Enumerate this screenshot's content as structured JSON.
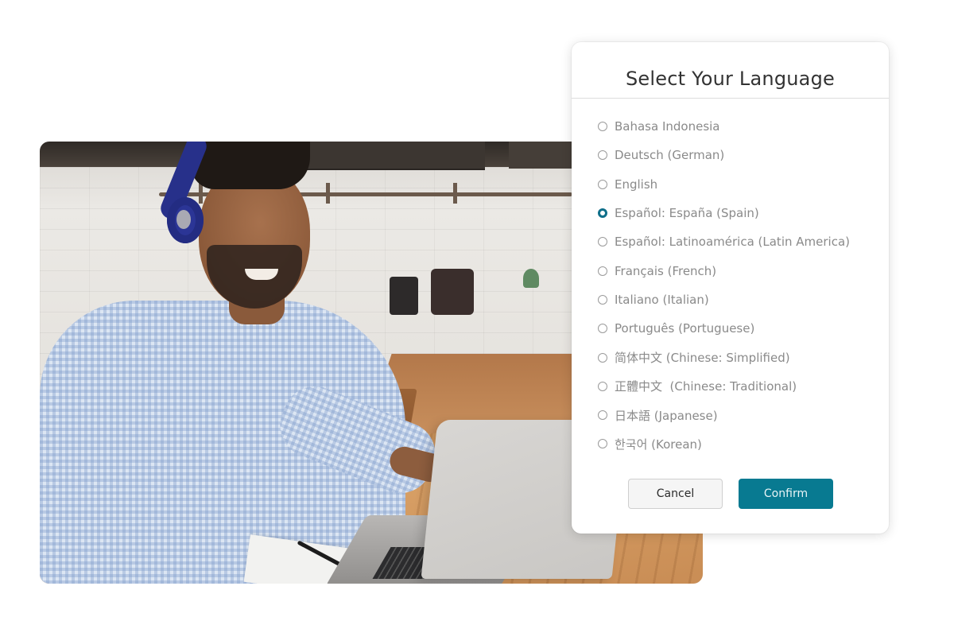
{
  "photo": {
    "description": "Man wearing blue headphones smiling at a laptop in a kitchen"
  },
  "dialog": {
    "title": "Select Your Language",
    "selected_index": 3,
    "options": [
      {
        "label": "Bahasa Indonesia",
        "checked": false
      },
      {
        "label": "Deutsch (German)",
        "checked": false
      },
      {
        "label": "English",
        "checked": false
      },
      {
        "label": "Español: España (Spain)",
        "checked": true
      },
      {
        "label": "Español: Latinoamérica (Latin America)",
        "checked": false
      },
      {
        "label": "Français (French)",
        "checked": false
      },
      {
        "label": "Italiano (Italian)",
        "checked": false
      },
      {
        "label": "Português (Portuguese)",
        "checked": false
      },
      {
        "label": "简体中文 (Chinese: Simplified)",
        "checked": false
      },
      {
        "label": "正體中文  (Chinese: Traditional)",
        "checked": false
      },
      {
        "label": "日本語 (Japanese)",
        "checked": false
      },
      {
        "label": "한국어 (Korean)",
        "checked": false
      }
    ],
    "buttons": {
      "cancel_label": "Cancel",
      "confirm_label": "Confirm"
    }
  },
  "colors": {
    "accent": "#087a91",
    "radio_checked": "#0f6f8a",
    "option_text": "#8a8a8a",
    "title_text": "#333333"
  }
}
